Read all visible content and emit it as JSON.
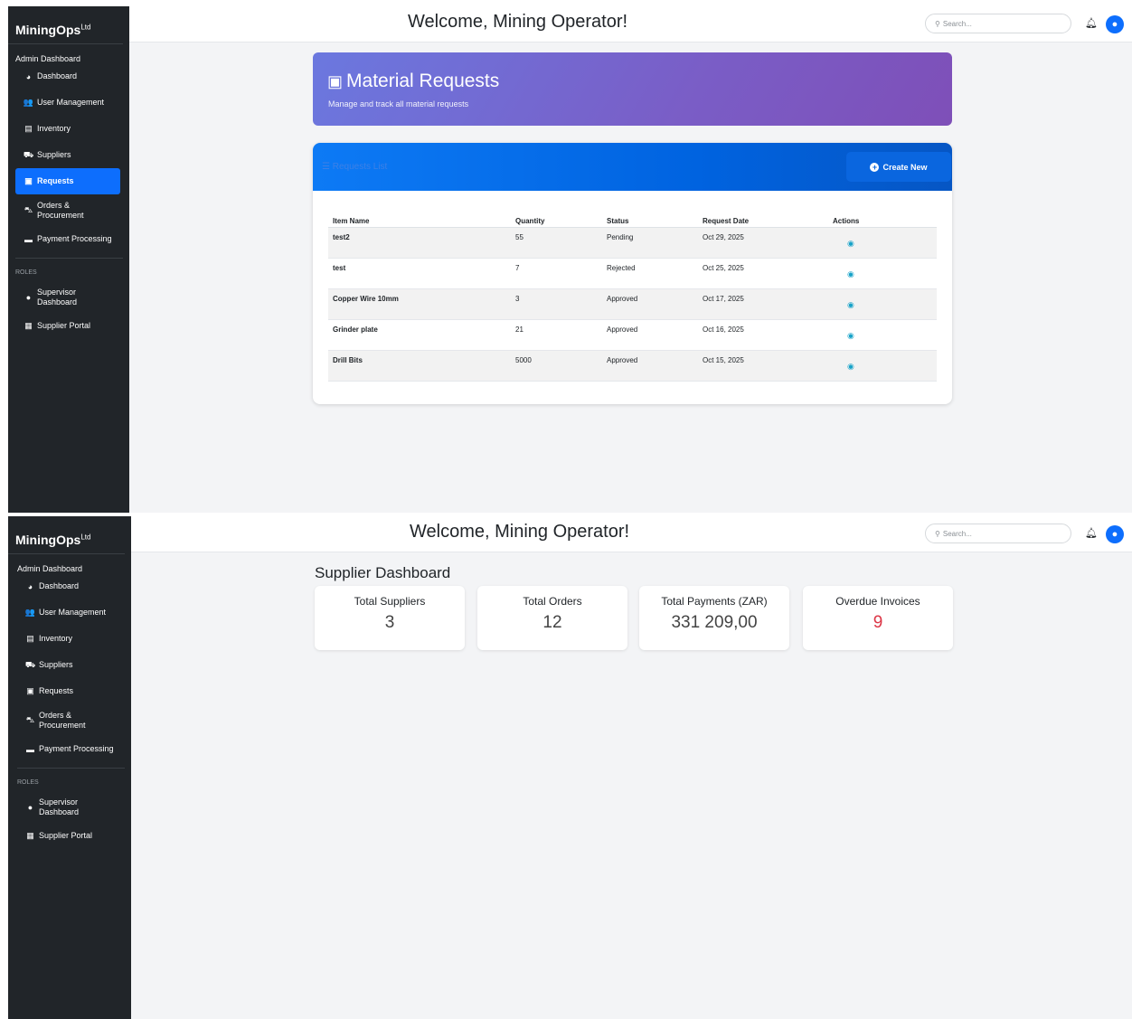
{
  "screen1": {
    "sidebar": {
      "brand": "MiningOps",
      "brand_suffix": "Ltd",
      "section": "Admin Dashboard",
      "roles_label": "ROLES",
      "items": [
        {
          "label": "Dashboard",
          "icon": "dashboard-gauge-icon"
        },
        {
          "label": "User Management",
          "icon": "users-icon"
        },
        {
          "label": "Inventory",
          "icon": "warehouse-icon"
        },
        {
          "label": "Suppliers",
          "icon": "truck-icon"
        },
        {
          "label": "Requests",
          "icon": "clipboard-icon"
        },
        {
          "label": "Orders & Procurement",
          "icon": "cart-icon"
        },
        {
          "label": "Payment Processing",
          "icon": "credit-card-icon"
        }
      ],
      "role_items": [
        {
          "label": "Supervisor Dashboard",
          "icon": "user-tie-icon"
        },
        {
          "label": "Supplier Portal",
          "icon": "people-carry-icon"
        }
      ]
    },
    "header": {
      "welcome": "Welcome, Mining Operator!",
      "search_placeholder": "Search..."
    },
    "hero": {
      "title": "Material Requests",
      "subtitle": "Manage and track all material requests"
    },
    "list": {
      "title": "Requests List",
      "create_label": "Create New",
      "columns": [
        "Item Name",
        "Quantity",
        "Status",
        "Request Date",
        "Actions"
      ],
      "rows": [
        {
          "item": "test2",
          "quantity": "55",
          "status": "Pending",
          "date": "Oct 29, 2025"
        },
        {
          "item": "test",
          "quantity": "7",
          "status": "Rejected",
          "date": "Oct 25, 2025"
        },
        {
          "item": "Copper Wire 10mm",
          "quantity": "3",
          "status": "Approved",
          "date": "Oct 17, 2025"
        },
        {
          "item": "Grinder plate",
          "quantity": "21",
          "status": "Approved",
          "date": "Oct 16, 2025"
        },
        {
          "item": "Drill Bits",
          "quantity": "5000",
          "status": "Approved",
          "date": "Oct 15, 2025"
        }
      ]
    }
  },
  "screen2": {
    "sidebar": {
      "brand": "MiningOps",
      "brand_suffix": "Ltd",
      "section": "Admin Dashboard",
      "roles_label": "ROLES",
      "items": [
        {
          "label": "Dashboard"
        },
        {
          "label": "User Management"
        },
        {
          "label": "Inventory"
        },
        {
          "label": "Suppliers"
        },
        {
          "label": "Requests"
        },
        {
          "label": "Orders & Procurement"
        },
        {
          "label": "Payment Processing"
        }
      ],
      "role_items": [
        {
          "label": "Supervisor Dashboard"
        },
        {
          "label": "Supplier Portal"
        }
      ]
    },
    "header": {
      "welcome": "Welcome, Mining Operator!",
      "search_placeholder": "Search..."
    },
    "dashboard": {
      "title": "Supplier Dashboard",
      "stats": [
        {
          "label": "Total Suppliers",
          "value": "3"
        },
        {
          "label": "Total Orders",
          "value": "12"
        },
        {
          "label": "Total Payments (ZAR)",
          "value": "331 209,00"
        },
        {
          "label": "Overdue Invoices",
          "value": "9"
        }
      ]
    }
  },
  "colors": {
    "sidebar": "#212529",
    "accent": "#0d6efd",
    "danger": "#dc3545",
    "info": "#17a2c8"
  }
}
